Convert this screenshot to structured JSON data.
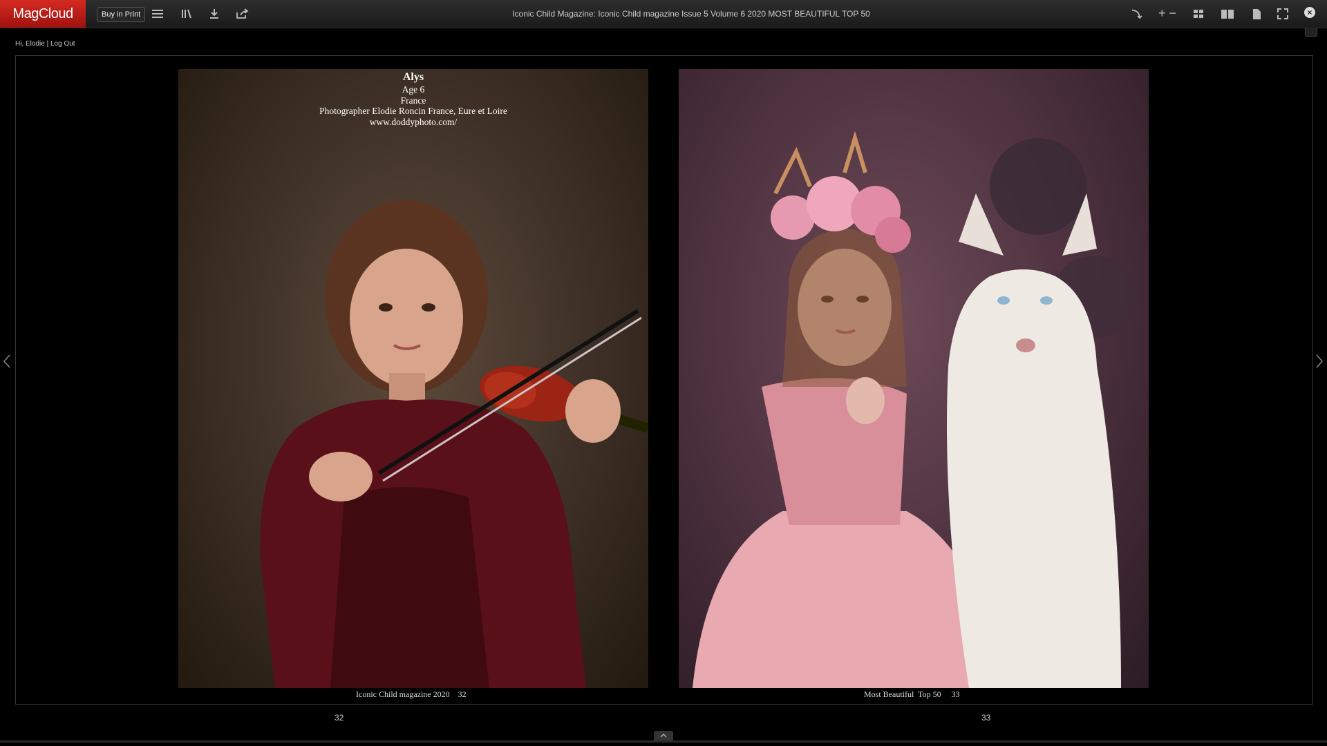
{
  "app": {
    "logo": "MagCloud"
  },
  "toolbar": {
    "buy_label": "Buy in Print",
    "title": "Iconic Child Magazine: Iconic Child magazine Issue 5 Volume 6 2020 MOST BEAUTIFUL TOP 50",
    "zoom_label": "+ −",
    "close_glyph": "×"
  },
  "user": {
    "greeting": "Hi, Elodie",
    "separator": "|",
    "logout": "Log Out"
  },
  "left_page": {
    "caption": {
      "name": "Alys",
      "age": "Age 6",
      "country": "France",
      "photographer": "Photographer Elodie Roncin France, Eure et Loire",
      "website": "www.doddyphoto.com/"
    },
    "footer": "Iconic Child magazine 2020    32",
    "page_number": "32"
  },
  "right_page": {
    "footer": "Most Beautiful  Top 50     33",
    "page_number": "33"
  },
  "colors": {
    "brand": "#c41d17",
    "background": "#000000",
    "toolbar": "#232323"
  },
  "icons": [
    "menu-icon",
    "library-icon",
    "download-icon",
    "share-icon",
    "flip-icon",
    "zoom-icon",
    "thumbnails-icon",
    "two-page-icon",
    "single-page-icon",
    "fullscreen-icon",
    "close-icon"
  ]
}
